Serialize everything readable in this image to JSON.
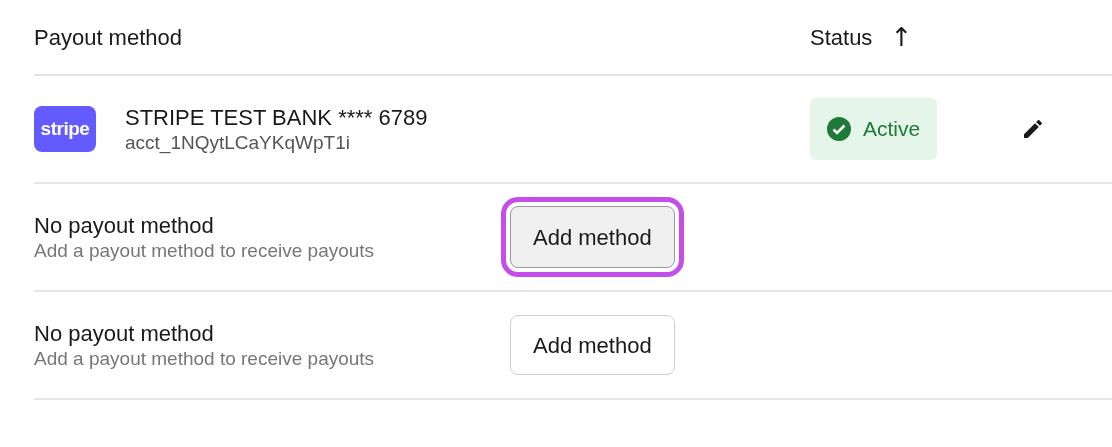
{
  "columns": [
    {
      "label": "Payout method"
    },
    {
      "label": "Status",
      "sort_arrow": "↑"
    }
  ],
  "rows": [
    {
      "kind": "account",
      "logo": "stripe",
      "name": "STRIPE TEST BANK **** 6789",
      "account_id": "acct_1NQytLCaYKqWpT1i",
      "status": "Active"
    },
    {
      "kind": "empty",
      "title": "No payout method",
      "subtitle": "Add a payout method to receive payouts",
      "button": "Add method",
      "focused": true
    },
    {
      "kind": "empty",
      "title": "No payout method",
      "subtitle": "Add a payout method to receive payouts",
      "button": "Add method",
      "focused": false
    }
  ]
}
